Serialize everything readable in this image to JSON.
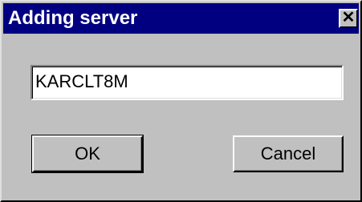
{
  "dialog": {
    "title": "Adding server",
    "close_symbol": "✕",
    "close_icon": "close-icon",
    "server_name_value": "KARCLT8M",
    "ok_label": "OK",
    "cancel_label": "Cancel"
  },
  "colors": {
    "titlebar": "#000080",
    "face": "#c0c0c0"
  }
}
